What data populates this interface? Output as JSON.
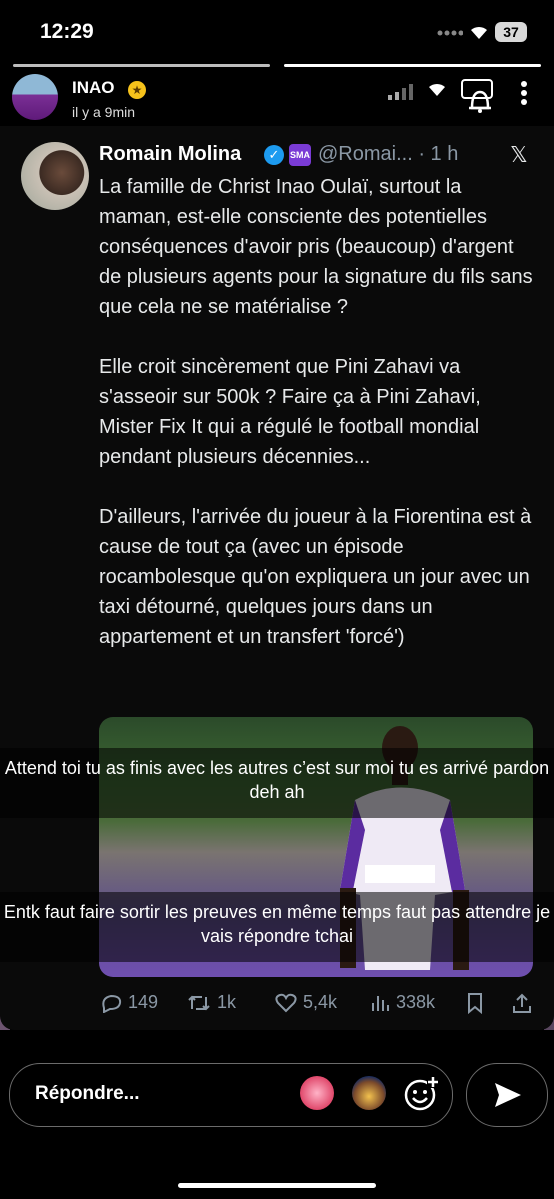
{
  "status_bar": {
    "time": "12:29",
    "battery": "37"
  },
  "story": {
    "username": "INAO",
    "age": "il y a 9min"
  },
  "tweet": {
    "name": "Romain Molina",
    "handle": "@Romai... · 1 h",
    "paragraphs": [
      "La famille de Christ Inao Oulaï, surtout la maman, est-elle consciente des potentielles conséquences d'avoir pris (beaucoup) d'argent de plusieurs agents pour la signature du fils sans que cela ne se matérialise ?",
      "Elle croit sincèrement que Pini Zahavi va s'asseoir sur 500k ? Faire ça à Pini Zahavi, Mister Fix It qui a régulé le football mondial pendant plusieurs décennies...",
      "D'ailleurs, l'arrivée du joueur à la Fiorentina est à cause de tout ça (avec un épisode rocambolesque qu'on expliquera un jour avec un taxi détourné, quelques jours dans un appartement et un transfert 'forcé')"
    ],
    "stats": {
      "replies": "149",
      "retweets": "1k",
      "likes": "5,4k",
      "views": "338k"
    }
  },
  "captions": [
    "Attend toi tu as finis avec les autres c’est sur moi tu es arrivé pardon deh ah",
    "Entk faut faire sortir les preuves en même temps faut pas attendre je vais répondre tchai"
  ],
  "reply": {
    "placeholder": "Répondre..."
  },
  "icons": [
    "signal-icon",
    "wifi-icon",
    "bell-icon",
    "more-icon",
    "verified-icon",
    "x-logo-icon",
    "reply-icon",
    "retweet-icon",
    "like-icon",
    "views-icon",
    "bookmark-icon",
    "share-icon",
    "add-emoji-icon",
    "send-icon"
  ]
}
